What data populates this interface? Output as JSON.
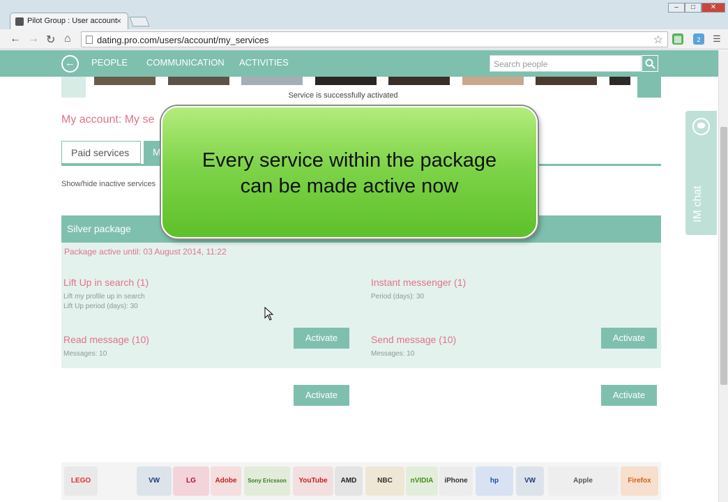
{
  "browser": {
    "tab_title": "Pilot Group : User account",
    "tab_close": "×",
    "url": "dating.pro.com/users/account/my_services",
    "window_controls": [
      "–",
      "□",
      "✕"
    ],
    "nav_icons": [
      "arrow-left-icon",
      "arrow-right-icon",
      "reload-icon",
      "home-icon"
    ],
    "extension_badge": "2"
  },
  "nav": {
    "links": [
      "PEOPLE",
      "COMMUNICATION",
      "ACTIVITIES"
    ],
    "search_placeholder": "Search people"
  },
  "notice": "Service is successfully activated",
  "account_title": "My account: My se",
  "tabs": {
    "paid": "Paid services",
    "my": "M"
  },
  "show_hide": "Show/hide inactive services",
  "package": {
    "name": "Silver package",
    "active_until": "Package active until: 03 August 2014, 11:22",
    "services": [
      {
        "title": "Lift Up in search (1)",
        "details": [
          "Lift my profile up in search",
          "Lift Up period (days): 30"
        ],
        "button": "Activate"
      },
      {
        "title": "Instant messenger (1)",
        "details": [
          "Period (days): 30"
        ],
        "button": "Activate"
      },
      {
        "title": "Read message (10)",
        "details": [
          "Messages: 10"
        ],
        "button": "Activate"
      },
      {
        "title": "Send message (10)",
        "details": [
          "Messages: 10"
        ],
        "button": "Activate"
      }
    ]
  },
  "im_chat": "IM chat",
  "callout": {
    "line1": "Every service within the package",
    "line2": "can be made active now"
  },
  "logos": [
    "LEGO",
    "VW",
    "LG",
    "Adobe",
    "Sony Ericsson",
    "YouTube",
    "AMD",
    "NBC",
    "nVIDIA",
    "iPhone",
    "hp",
    "VW",
    "Apple",
    "Firefox"
  ],
  "colors": {
    "accent": "#7fbfae",
    "link": "#e0728a",
    "callout_green": "#7fd44a"
  }
}
